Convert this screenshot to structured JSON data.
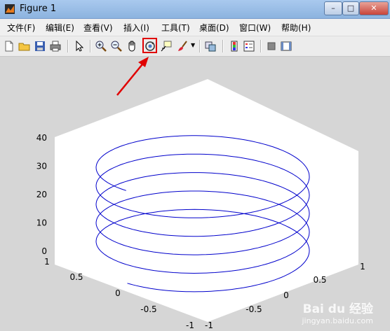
{
  "window": {
    "title": "Figure 1"
  },
  "menu": [
    {
      "label": "文件(F)"
    },
    {
      "label": "编辑(E)"
    },
    {
      "label": "查看(V)"
    },
    {
      "label": "插入(I)"
    },
    {
      "label": "工具(T)"
    },
    {
      "label": "桌面(D)"
    },
    {
      "label": "窗口(W)"
    },
    {
      "label": "帮助(H)"
    }
  ],
  "toolbar": {
    "icons": [
      "new-figure-icon",
      "open-file-icon",
      "save-icon",
      "print-icon",
      "edit-plot-arrow-icon",
      "zoom-in-icon",
      "zoom-out-icon",
      "pan-hand-icon",
      "rotate-3d-icon",
      "data-cursor-icon",
      "brush-icon",
      "link-plot-icon",
      "colorbar-icon",
      "legend-icon",
      "hide-plot-tools-icon",
      "show-plot-tools-icon"
    ]
  },
  "annotation": {
    "color": "#e00000",
    "target": "rotate-3d-icon"
  },
  "colors": {
    "line": "#0000cc",
    "background": "#d6d6d6",
    "axes_bg": "#ffffff"
  },
  "chart_data": {
    "type": "line",
    "projection": "3d",
    "series": [
      {
        "function": "x = sin(t), y = cos(t), z = t",
        "t_range": [
          0,
          31.4
        ],
        "color": "#0000cc"
      }
    ],
    "zlim": [
      0,
      40
    ],
    "xlim": [
      -1,
      1
    ],
    "ylim": [
      -1,
      1
    ],
    "z_ticks": [
      "0",
      "10",
      "20",
      "30",
      "40"
    ],
    "x_ticks": [
      "1",
      "0.5",
      "0",
      "-0.5",
      "-1"
    ],
    "y_ticks": [
      "-1",
      "-0.5",
      "0",
      "0.5",
      "1"
    ],
    "grid": false
  },
  "watermark": {
    "line1": "Bai du 经验",
    "line2": "jingyan.baidu.com"
  }
}
